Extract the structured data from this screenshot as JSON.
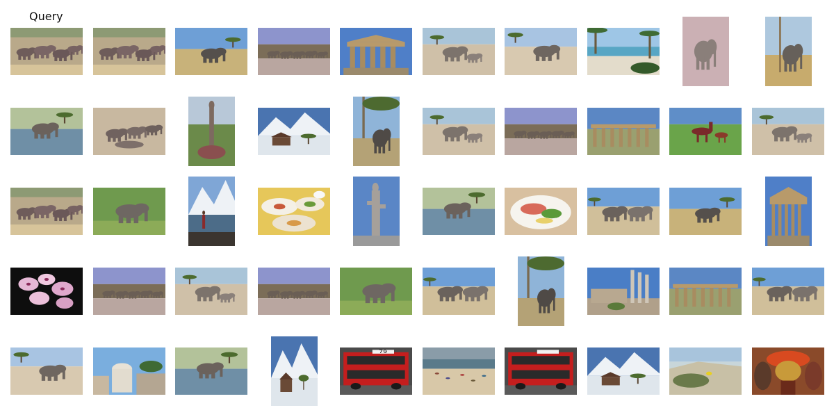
{
  "query_label": "Query",
  "colors": {
    "background": "#ffffff",
    "savanna_sky": "#6e9fd6",
    "dry_grass": "#c8b27a",
    "elephant_gray": "#7c736c",
    "water": "#6f8fa6",
    "ruin_stone": "#b89a6a",
    "bus_red": "#c41e1e",
    "snow": "#eef2f6"
  },
  "rows": [
    [
      {
        "scene": "elephant-herd-dust",
        "orientation": "landscape",
        "role": "query"
      },
      {
        "scene": "elephant-herd-dust",
        "orientation": "landscape"
      },
      {
        "scene": "elephant-savanna",
        "orientation": "landscape"
      },
      {
        "scene": "elephant-herd-distant",
        "orientation": "landscape"
      },
      {
        "scene": "temple-ruin",
        "orientation": "landscape"
      },
      {
        "scene": "elephant-mother-calf",
        "orientation": "landscape"
      },
      {
        "scene": "elephant-grass",
        "orientation": "landscape"
      },
      {
        "scene": "beach-palms",
        "orientation": "landscape"
      },
      {
        "scene": "elephant-standing",
        "orientation": "portrait"
      },
      {
        "scene": "elephant-standing-tree",
        "orientation": "portrait"
      }
    ],
    [
      {
        "scene": "elephant-water",
        "orientation": "landscape"
      },
      {
        "scene": "elephant-herd-lying",
        "orientation": "landscape"
      },
      {
        "scene": "statue-garden",
        "orientation": "portrait"
      },
      {
        "scene": "snowy-mountain-village",
        "orientation": "landscape"
      },
      {
        "scene": "elephant-under-tree",
        "orientation": "portrait"
      },
      {
        "scene": "elephant-mother-calf",
        "orientation": "landscape"
      },
      {
        "scene": "elephant-herd-distant",
        "orientation": "landscape"
      },
      {
        "scene": "temple-ruin-long",
        "orientation": "landscape"
      },
      {
        "scene": "horses-grass",
        "orientation": "landscape"
      },
      {
        "scene": "elephant-mother-calf",
        "orientation": "landscape"
      }
    ],
    [
      {
        "scene": "elephant-herd-dust",
        "orientation": "landscape"
      },
      {
        "scene": "elephant-green",
        "orientation": "landscape"
      },
      {
        "scene": "hiker-mountain-lake",
        "orientation": "portrait"
      },
      {
        "scene": "food-platter",
        "orientation": "landscape"
      },
      {
        "scene": "statue-sky",
        "orientation": "portrait"
      },
      {
        "scene": "elephant-water",
        "orientation": "landscape"
      },
      {
        "scene": "food-plate",
        "orientation": "landscape"
      },
      {
        "scene": "elephant-pair",
        "orientation": "landscape"
      },
      {
        "scene": "elephant-savanna",
        "orientation": "landscape"
      },
      {
        "scene": "temple-ruin",
        "orientation": "portrait"
      }
    ],
    [
      {
        "scene": "pink-flowers",
        "orientation": "landscape"
      },
      {
        "scene": "elephant-herd-distant",
        "orientation": "landscape"
      },
      {
        "scene": "elephant-mother-calf",
        "orientation": "landscape"
      },
      {
        "scene": "elephant-herd-distant",
        "orientation": "landscape"
      },
      {
        "scene": "elephant-green",
        "orientation": "landscape"
      },
      {
        "scene": "elephant-pair",
        "orientation": "landscape"
      },
      {
        "scene": "elephant-under-tree",
        "orientation": "portrait"
      },
      {
        "scene": "colosseum-ruins",
        "orientation": "landscape"
      },
      {
        "scene": "temple-ruin-long",
        "orientation": "landscape"
      },
      {
        "scene": "elephant-pair",
        "orientation": "landscape"
      }
    ],
    [
      {
        "scene": "elephant-grass",
        "orientation": "landscape"
      },
      {
        "scene": "city-dome",
        "orientation": "landscape"
      },
      {
        "scene": "elephant-water",
        "orientation": "landscape"
      },
      {
        "scene": "snowy-mountain-village",
        "orientation": "portrait"
      },
      {
        "scene": "red-bus",
        "orientation": "landscape",
        "bus_number": "79"
      },
      {
        "scene": "beach-crowd",
        "orientation": "landscape"
      },
      {
        "scene": "red-bus",
        "orientation": "landscape"
      },
      {
        "scene": "snowy-mountain-village",
        "orientation": "landscape"
      },
      {
        "scene": "beach-dunes",
        "orientation": "landscape"
      },
      {
        "scene": "tribal-portrait",
        "orientation": "landscape"
      }
    ]
  ]
}
